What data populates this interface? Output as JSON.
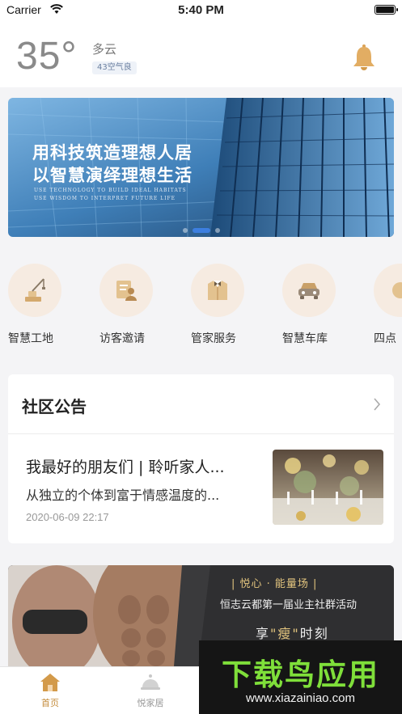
{
  "status_bar": {
    "carrier": "Carrier",
    "time": "5:40 PM"
  },
  "weather": {
    "temperature": "35°",
    "condition": "多云",
    "air_quality": "43空气良"
  },
  "banner": {
    "title_line1": "用科技筑造理想人居",
    "title_line2": "以智慧演绎理想生活",
    "subtitle_line1": "USE TECHNOLOGY TO BUILD IDEAL HABITATS",
    "subtitle_line2": "USE WISDOM TO INTERPRET FUTURE LIFE",
    "active_slide": 2,
    "slide_count": 3
  },
  "services": [
    {
      "label": "智慧工地",
      "icon": "crane-icon"
    },
    {
      "label": "访客邀请",
      "icon": "visitor-card-icon"
    },
    {
      "label": "管家服务",
      "icon": "butler-suit-icon"
    },
    {
      "label": "智慧车库",
      "icon": "car-icon"
    },
    {
      "label": "四点",
      "icon": "partial-service-icon"
    }
  ],
  "notice": {
    "title": "社区公告",
    "news_title": "我最好的朋友们 | 聆听家人...",
    "news_desc": "从独立的个体到富于情感温度的...",
    "news_date": "2020-06-09 22:17"
  },
  "promo": {
    "line1": "| 悦心 · 能量场 |",
    "line2": "恒志云都第一届业主社群活动",
    "line3_pre": "享",
    "line3_highlight": "\"瘦\"",
    "line3_post": "时刻"
  },
  "tabs": [
    {
      "label": "首页",
      "active": true
    },
    {
      "label": "悦家居",
      "active": false
    }
  ],
  "watermark": {
    "title": "下载鸟应用",
    "url": "www.xiazainiao.com"
  },
  "colors": {
    "accent": "#d39a4a",
    "service_bg": "#f6ebe1",
    "active_dot": "#3d7fe0",
    "watermark_green": "#7fdf3a"
  }
}
